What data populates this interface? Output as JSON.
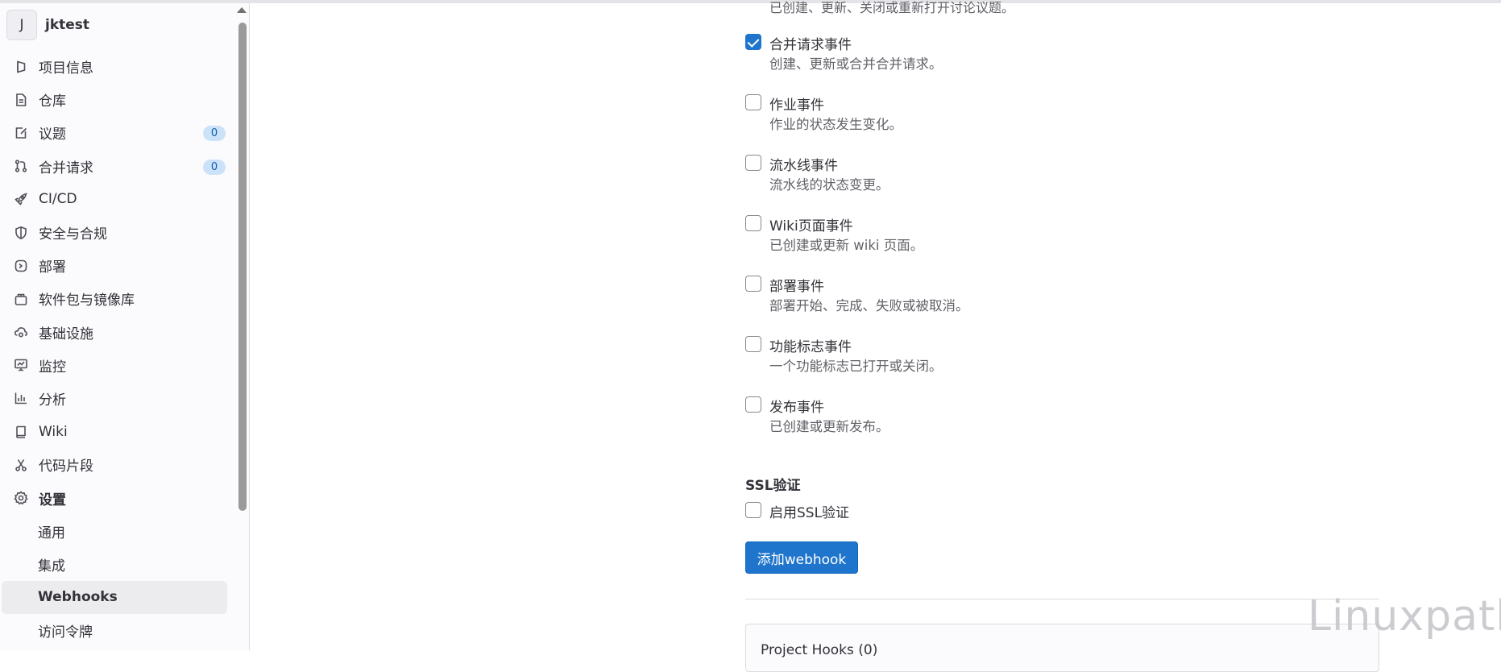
{
  "project": {
    "avatar_letter": "J",
    "name": "jktest"
  },
  "sidebar": {
    "items": [
      {
        "label": "项目信息",
        "icon": "project-info-icon"
      },
      {
        "label": "仓库",
        "icon": "document-icon"
      },
      {
        "label": "议题",
        "icon": "issues-icon",
        "count": "0"
      },
      {
        "label": "合并请求",
        "icon": "merge-request-icon",
        "count": "0"
      },
      {
        "label": "CI/CD",
        "icon": "rocket-icon"
      },
      {
        "label": "安全与合规",
        "icon": "shield-icon"
      },
      {
        "label": "部署",
        "icon": "deployments-icon"
      },
      {
        "label": "软件包与镜像库",
        "icon": "package-icon"
      },
      {
        "label": "基础设施",
        "icon": "cloud-gear-icon"
      },
      {
        "label": "监控",
        "icon": "monitor-icon"
      },
      {
        "label": "分析",
        "icon": "chart-icon"
      },
      {
        "label": "Wiki",
        "icon": "book-icon"
      },
      {
        "label": "代码片段",
        "icon": "scissors-icon"
      },
      {
        "label": "设置",
        "icon": "settings-icon"
      }
    ],
    "settings_sub": [
      {
        "label": "通用"
      },
      {
        "label": "集成"
      },
      {
        "label": "Webhooks",
        "active": true
      },
      {
        "label": "访问令牌"
      }
    ]
  },
  "main": {
    "clipped_text": "已创建、更新、关闭或重新打开讨论议题。",
    "events": [
      {
        "title": "合并请求事件",
        "desc": "创建、更新或合并合并请求。",
        "checked": true
      },
      {
        "title": "作业事件",
        "desc": "作业的状态发生变化。",
        "checked": false
      },
      {
        "title": "流水线事件",
        "desc": "流水线的状态变更。",
        "checked": false
      },
      {
        "title": "Wiki页面事件",
        "desc": "已创建或更新 wiki 页面。",
        "checked": false
      },
      {
        "title": "部署事件",
        "desc": "部署开始、完成、失败或被取消。",
        "checked": false
      },
      {
        "title": "功能标志事件",
        "desc": "一个功能标志已打开或关闭。",
        "checked": false
      },
      {
        "title": "发布事件",
        "desc": "已创建或更新发布。",
        "checked": false
      }
    ],
    "ssl": {
      "title": "SSL验证",
      "checkbox_label": "启用SSL验证",
      "checked": false
    },
    "add_button": "添加webhook",
    "project_hooks_title": "Project Hooks (0)"
  },
  "watermark": "Linuxpath",
  "colors": {
    "accent": "#1f75cb",
    "badge_bg": "#cbe2f9",
    "sidebar_bg": "#fbfafd"
  }
}
